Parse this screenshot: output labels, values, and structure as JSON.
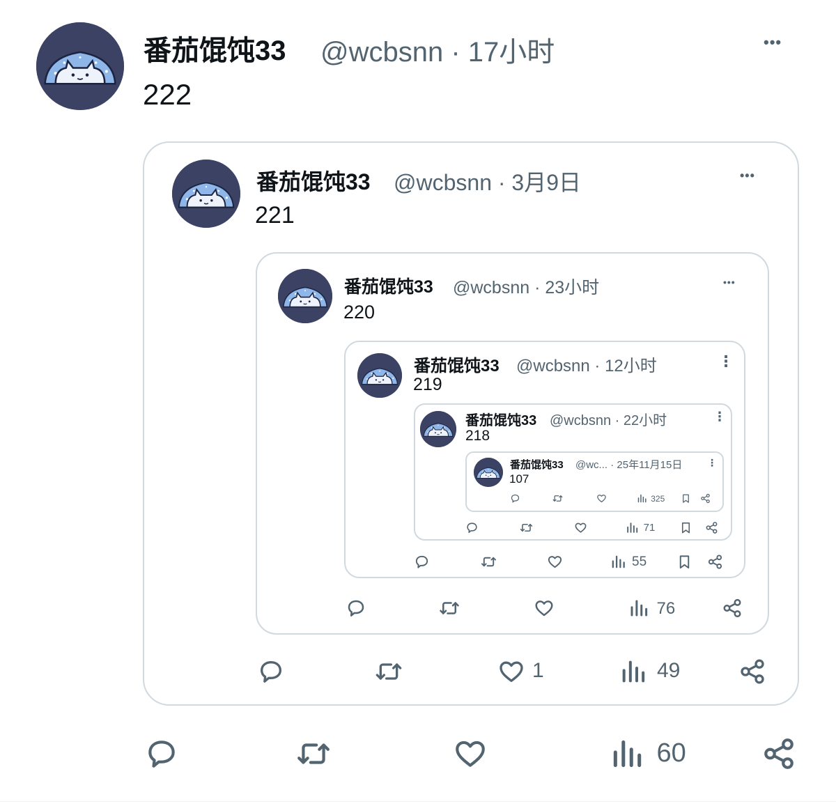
{
  "tweets": [
    {
      "author": "番茄馄饨33",
      "handle_time": "@wcbsnn · 17小时",
      "text": "222",
      "more": "•••",
      "reply_count": "",
      "retweet_count": "",
      "like_count": "",
      "views": "60"
    },
    {
      "author": "番茄馄饨33",
      "handle_time": "@wcbsnn · 3月9日",
      "text": "221",
      "more": "•••",
      "like_count": "1",
      "views": "49"
    },
    {
      "author": "番茄馄饨33",
      "handle_time": "@wcbsnn · 23小时",
      "text": "220",
      "more": "•••",
      "views": "76"
    },
    {
      "author": "番茄馄饨33",
      "handle_time": "@wcbsnn · 12小时",
      "text": "219",
      "more": "⋮",
      "views": "55"
    },
    {
      "author": "番茄馄饨33",
      "handle_time": "@wcbsnn · 22小时",
      "text": "218",
      "more": "⋮",
      "views": "71"
    },
    {
      "author": "番茄馄饨33",
      "handle_time": "@wc... · 25年11月15日",
      "text": "107",
      "more": "⋮",
      "views": "325"
    }
  ],
  "icons": {
    "reply": "reply-icon",
    "retweet": "retweet-icon",
    "like": "like-icon",
    "views": "views-icon",
    "bookmark": "bookmark-icon",
    "share": "share-icon"
  },
  "colors": {
    "text": "#0f1419",
    "secondary": "#536471",
    "border": "#cfd9de",
    "avatar_bg": "#3b4264",
    "cat_blue": "#8fb6e8"
  }
}
